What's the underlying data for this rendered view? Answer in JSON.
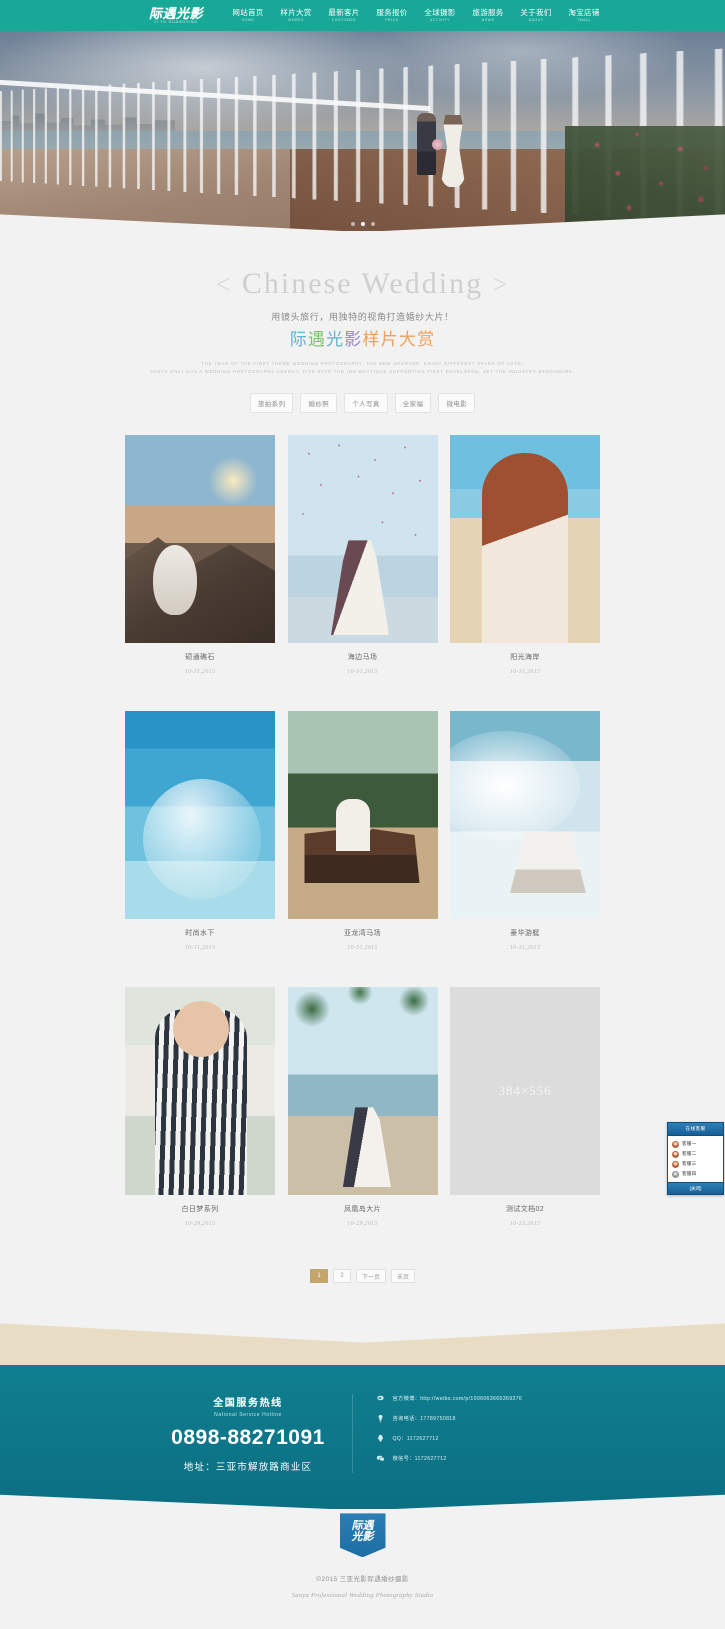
{
  "header": {
    "logo_cn": "际遇光影",
    "logo_en": "JI YU GUANGYING",
    "nav": [
      {
        "cn": "网站首页",
        "en": "HOME"
      },
      {
        "cn": "样片大赏",
        "en": "WORKS"
      },
      {
        "cn": "最新客片",
        "en": "CUSTOMER"
      },
      {
        "cn": "服务报价",
        "en": "PRICE"
      },
      {
        "cn": "全球摄影",
        "en": "ACTIVITY"
      },
      {
        "cn": "旅游服务",
        "en": "NEWS"
      },
      {
        "cn": "关于我们",
        "en": "ABOUT"
      },
      {
        "cn": "淘宝店铺",
        "en": "TMALL"
      }
    ]
  },
  "hero": {
    "dots": [
      "",
      "",
      ""
    ],
    "active_dot": 1
  },
  "title": {
    "bracket_left": "<",
    "en": "Chinese Wedding",
    "bracket_right": ">",
    "sub_cn": "用镜头旅行，用独特的视角打造婚纱大片！",
    "cn_part1": "际",
    "cn_part2": "遇",
    "cn_part3": "光",
    "cn_part4": "影",
    "cn_part5": "样片大赏",
    "en_line1": "THE YEAR OF THE FIRST THEME WEDDING PHOTOGRAPHY, THE NEW UPGRADE, ENJOY DIFFERENT SPARK OF LOVE!",
    "en_line2": "SANYA ONLY HAS A WEDDING PHOTOGRAPHY AGENCY, FIVE STAR THE INN BOUTIQUE SUPPORTING FIRST DEVELOPED, SET THE INDUSTRY BENCHMARK."
  },
  "filters": [
    {
      "label": "旅拍系列"
    },
    {
      "label": "婚纱照"
    },
    {
      "label": "个人写真"
    },
    {
      "label": "全家福"
    },
    {
      "label": "微电影"
    }
  ],
  "gallery": {
    "items": [
      {
        "title": "硕通礁石",
        "date": "10-31,2015",
        "art": "img-rocks",
        "placeholder": ""
      },
      {
        "title": "海边马场",
        "date": "10-31,2015",
        "art": "img-petals",
        "placeholder": ""
      },
      {
        "title": "阳光海岸",
        "date": "10-31,2015",
        "art": "img-beachgirl",
        "placeholder": ""
      },
      {
        "title": "时尚水下",
        "date": "10-31,2015",
        "art": "img-underwater",
        "placeholder": ""
      },
      {
        "title": "亚龙湾马场",
        "date": "10-31,2015",
        "art": "img-horse",
        "placeholder": ""
      },
      {
        "title": "豪华游艇",
        "date": "10-31,2015",
        "art": "img-yacht",
        "placeholder": ""
      },
      {
        "title": "白日梦系列",
        "date": "10-29,2015",
        "art": "img-daydream",
        "placeholder": ""
      },
      {
        "title": "凤凰岛大片",
        "date": "10-29,2015",
        "art": "img-phoenix",
        "placeholder": ""
      },
      {
        "title": "测试文档02",
        "date": "10-23,2015",
        "art": "img-placeholder",
        "placeholder": "384×556"
      }
    ]
  },
  "pagination": {
    "pages": [
      {
        "label": "1",
        "active": true
      },
      {
        "label": "2",
        "active": false
      },
      {
        "label": "下一页",
        "active": false
      },
      {
        "label": "末页",
        "active": false
      }
    ]
  },
  "footer": {
    "hotline_cn": "全国服务热线",
    "hotline_en": "National Service Hotline",
    "phone": "0898-88271091",
    "address": "地址：三亚市解放路商业区",
    "contacts": [
      {
        "icon": "weibo-icon",
        "text": "官方微博：http://weibo.com/p/1006063666369376"
      },
      {
        "icon": "phone-icon",
        "text": "咨询电话：17789750818"
      },
      {
        "icon": "qq-icon",
        "text": "QQ：1172627712"
      },
      {
        "icon": "wechat-icon",
        "text": "微信号：1172627712"
      }
    ]
  },
  "bottom": {
    "logo_line1": "际遇",
    "logo_line2": "光影",
    "copyright_cn": "©2015 三亚光影际遇婚纱摄影",
    "copyright_en": "Sanya Professional Wedding Photography Studio"
  },
  "service_widget": {
    "title": "在线客服",
    "items": [
      {
        "label": "客服一",
        "gray": false
      },
      {
        "label": "客服二",
        "gray": false
      },
      {
        "label": "客服三",
        "gray": false
      },
      {
        "label": "客服四",
        "gray": true
      }
    ],
    "close_label": "[关闭]"
  },
  "colors": {
    "brand_teal": "#18a898",
    "footer_teal": "#0f7f8e",
    "gold_active": "#c4a66c",
    "sand": "#e9dcc4",
    "page_bg": "#f2f2f2"
  }
}
